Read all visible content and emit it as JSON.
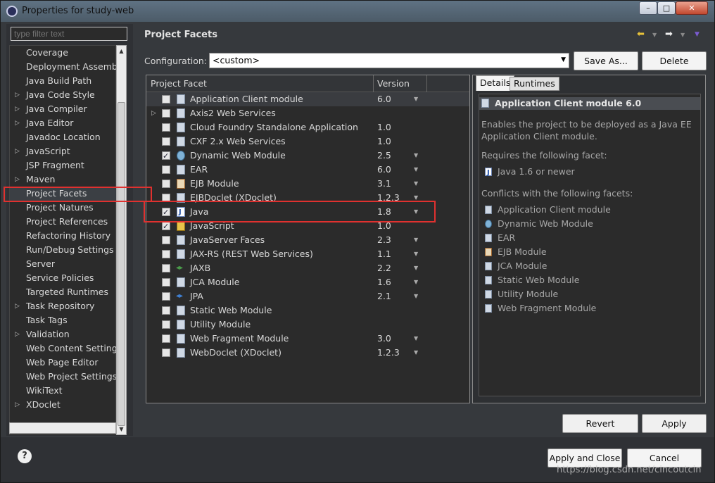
{
  "window": {
    "title": "Properties for study-web",
    "controls": {
      "minimize": "–",
      "maximize": "□",
      "close": "✕"
    }
  },
  "filter": {
    "placeholder": "type filter text"
  },
  "nav": {
    "items": [
      {
        "label": "Coverage",
        "expandable": false
      },
      {
        "label": "Deployment Assembly",
        "expandable": false
      },
      {
        "label": "Java Build Path",
        "expandable": false
      },
      {
        "label": "Java Code Style",
        "expandable": true
      },
      {
        "label": "Java Compiler",
        "expandable": true
      },
      {
        "label": "Java Editor",
        "expandable": true
      },
      {
        "label": "Javadoc Location",
        "expandable": false
      },
      {
        "label": "JavaScript",
        "expandable": true
      },
      {
        "label": "JSP Fragment",
        "expandable": false
      },
      {
        "label": "Maven",
        "expandable": true
      },
      {
        "label": "Project Facets",
        "expandable": false,
        "selected": true
      },
      {
        "label": "Project Natures",
        "expandable": false
      },
      {
        "label": "Project References",
        "expandable": false
      },
      {
        "label": "Refactoring History",
        "expandable": false
      },
      {
        "label": "Run/Debug Settings",
        "expandable": false
      },
      {
        "label": "Server",
        "expandable": false
      },
      {
        "label": "Service Policies",
        "expandable": false
      },
      {
        "label": "Targeted Runtimes",
        "expandable": false
      },
      {
        "label": "Task Repository",
        "expandable": true
      },
      {
        "label": "Task Tags",
        "expandable": false
      },
      {
        "label": "Validation",
        "expandable": true
      },
      {
        "label": "Web Content Settings",
        "expandable": false
      },
      {
        "label": "Web Page Editor",
        "expandable": false
      },
      {
        "label": "Web Project Settings",
        "expandable": false
      },
      {
        "label": "WikiText",
        "expandable": false
      },
      {
        "label": "XDoclet",
        "expandable": true
      }
    ]
  },
  "page": {
    "title": "Project Facets"
  },
  "config": {
    "label": "Configuration:",
    "value": "<custom>"
  },
  "buttons": {
    "save_as": "Save As...",
    "delete": "Delete",
    "revert": "Revert",
    "apply": "Apply",
    "apply_close": "Apply and Close",
    "cancel": "Cancel"
  },
  "facets": {
    "col_facet": "Project Facet",
    "col_version": "Version",
    "rows": [
      {
        "name": "Application Client module",
        "version": "6.0",
        "checked": false,
        "icon": "doc-icon",
        "dropdown": true,
        "selected": true
      },
      {
        "name": "Axis2 Web Services",
        "version": "",
        "checked": false,
        "icon": "doc-icon",
        "dropdown": false,
        "expandable": true
      },
      {
        "name": "Cloud Foundry Standalone Application",
        "version": "1.0",
        "checked": false,
        "icon": "doc-icon",
        "dropdown": false
      },
      {
        "name": "CXF 2.x Web Services",
        "version": "1.0",
        "checked": false,
        "icon": "doc-icon",
        "dropdown": false
      },
      {
        "name": "Dynamic Web Module",
        "version": "2.5",
        "checked": true,
        "icon": "globe-icon",
        "dropdown": true
      },
      {
        "name": "EAR",
        "version": "6.0",
        "checked": false,
        "icon": "doc-icon",
        "dropdown": true
      },
      {
        "name": "EJB Module",
        "version": "3.1",
        "checked": false,
        "icon": "ejb-icon",
        "dropdown": true
      },
      {
        "name": "EJBDoclet (XDoclet)",
        "version": "1.2.3",
        "checked": false,
        "icon": "doc-icon",
        "dropdown": true
      },
      {
        "name": "Java",
        "version": "1.8",
        "checked": true,
        "icon": "java-icon",
        "dropdown": true
      },
      {
        "name": "JavaScript",
        "version": "1.0",
        "checked": true,
        "icon": "js-icon",
        "dropdown": false
      },
      {
        "name": "JavaServer Faces",
        "version": "2.3",
        "checked": false,
        "icon": "doc-icon",
        "dropdown": true
      },
      {
        "name": "JAX-RS (REST Web Services)",
        "version": "1.1",
        "checked": false,
        "icon": "doc-icon",
        "dropdown": true
      },
      {
        "name": "JAXB",
        "version": "2.2",
        "checked": false,
        "icon": "jaxb-icon",
        "dropdown": true
      },
      {
        "name": "JCA Module",
        "version": "1.6",
        "checked": false,
        "icon": "doc-icon",
        "dropdown": true
      },
      {
        "name": "JPA",
        "version": "2.1",
        "checked": false,
        "icon": "jpa-icon",
        "dropdown": true
      },
      {
        "name": "Static Web Module",
        "version": "",
        "checked": false,
        "icon": "doc-icon",
        "dropdown": false
      },
      {
        "name": "Utility Module",
        "version": "",
        "checked": false,
        "icon": "doc-icon",
        "dropdown": false
      },
      {
        "name": "Web Fragment Module",
        "version": "3.0",
        "checked": false,
        "icon": "doc-icon",
        "dropdown": true
      },
      {
        "name": "WebDoclet (XDoclet)",
        "version": "1.2.3",
        "checked": false,
        "icon": "doc-icon",
        "dropdown": true
      }
    ]
  },
  "details": {
    "tabs": [
      "Details",
      "Runtimes"
    ],
    "heading": "Application Client module 6.0",
    "desc_line1": "Enables the project to be deployed as a Java EE",
    "desc_line2": "Application Client module.",
    "requires_label": "Requires the following facet:",
    "requires": [
      {
        "name": "Java 1.6 or newer",
        "icon": "java-icon"
      }
    ],
    "conflicts_label": "Conflicts with the following facets:",
    "conflicts": [
      {
        "name": "Application Client module",
        "icon": "doc-icon"
      },
      {
        "name": "Dynamic Web Module",
        "icon": "globe-icon"
      },
      {
        "name": "EAR",
        "icon": "doc-icon"
      },
      {
        "name": "EJB Module",
        "icon": "ejb-icon"
      },
      {
        "name": "JCA Module",
        "icon": "doc-icon"
      },
      {
        "name": "Static Web Module",
        "icon": "doc-icon"
      },
      {
        "name": "Utility Module",
        "icon": "doc-icon"
      },
      {
        "name": "Web Fragment Module",
        "icon": "doc-icon"
      }
    ]
  },
  "help": {
    "symbol": "?"
  },
  "watermark": "https://blog.csdn.net/cincoutcin",
  "colors": {
    "highlight_box": "#e0312f",
    "background": "#36393d"
  }
}
